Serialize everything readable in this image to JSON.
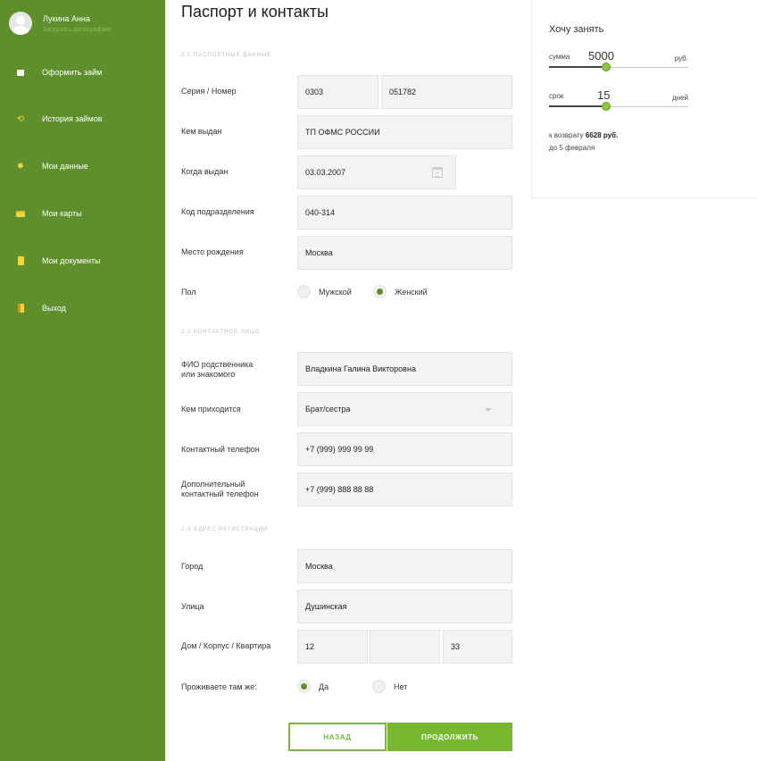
{
  "sidebar": {
    "user_name": "Лукина Анна",
    "upload_photo": "Загрузить фотографию",
    "items": [
      {
        "label": "Оформить займ",
        "icon": "wallet-icon"
      },
      {
        "label": "История займов",
        "icon": "history-icon"
      },
      {
        "label": "Мои данные",
        "icon": "gear-icon"
      },
      {
        "label": "Мои карты",
        "icon": "card-icon"
      },
      {
        "label": "Мои документы",
        "icon": "document-icon"
      },
      {
        "label": "Выход",
        "icon": "exit-icon"
      }
    ]
  },
  "page": {
    "title": "Паспорт и контакты"
  },
  "passport": {
    "section_title": "2.1 паспортные данные",
    "series_label": "Серия / Номер",
    "series": "0303",
    "number": "051782",
    "issued_by_label": "Кем выдан",
    "issued_by": "ТП ОФМС РОССИИ",
    "issue_date_label": "Когда выдан",
    "issue_date": "03.03.2007",
    "division_code_label": "Код подразделения",
    "division_code": "040-314",
    "birthplace_label": "Место рождения",
    "birthplace": "Москва",
    "gender_label": "Пол",
    "gender_male": "Мужской",
    "gender_female": "Женский",
    "gender_selected": "female"
  },
  "contact": {
    "section_title": "2.2 контактное лицо",
    "name_label_line1": "ФИО родственника",
    "name_label_line2": "или знакомого",
    "name": "Владкина Галина Викторовна",
    "relation_label": "Кем приходится",
    "relation": "Брат/сестра",
    "phone_label": "Контактный телефон",
    "phone": "+7 (999) 999 99 99",
    "extra_phone_label_line1": "Дополнительный",
    "extra_phone_label_line2": "контактный телефон",
    "extra_phone": "+7 (999) 888 88 88"
  },
  "address": {
    "section_title": "2.3 адрес регистрации",
    "city_label": "Город",
    "city": "Москва",
    "street_label": "Улица",
    "street": "Душинская",
    "house_label": "Дом / Корпус / Квартира",
    "house": "12",
    "building": "",
    "apartment": "33",
    "live_there_label": "Проживаете там же:",
    "yes": "Да",
    "no": "Нет",
    "live_there_selected": "yes"
  },
  "buttons": {
    "back": "Назад",
    "next": "Продолжить"
  },
  "loan": {
    "title": "Хочу занять",
    "sum_label": "сумма",
    "sum_value": "5000",
    "sum_unit": "руб.",
    "sum_fraction": 0.41,
    "term_label": "срок",
    "term_value": "15",
    "term_unit": "дней",
    "term_fraction": 0.41,
    "return_prefix": "к возврату",
    "return_amount": "6628 руб.",
    "due_date": "до 5 февраля"
  },
  "colors": {
    "sidebar": "#5e8f2c",
    "accent": "#76b82f",
    "icon": "#f6d53b"
  }
}
